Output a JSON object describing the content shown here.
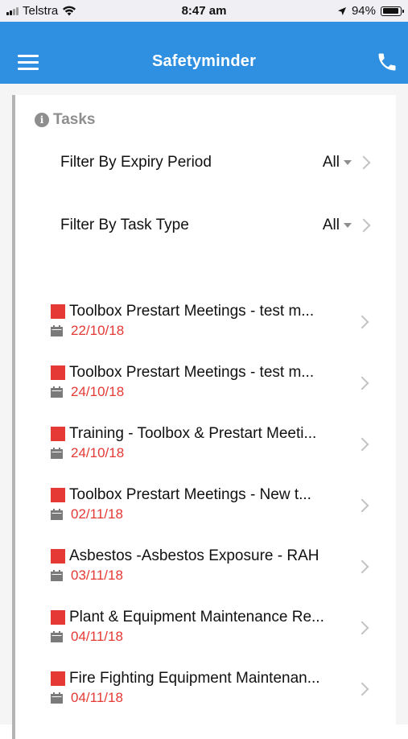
{
  "status_bar": {
    "carrier": "Telstra",
    "time": "8:47 am",
    "battery": "94%"
  },
  "header": {
    "title": "Safetyminder"
  },
  "section": {
    "title": "Tasks"
  },
  "filters": [
    {
      "label": "Filter By Expiry Period",
      "value": "All"
    },
    {
      "label": "Filter By Task Type",
      "value": "All"
    }
  ],
  "tasks": [
    {
      "title": "Toolbox Prestart Meetings - test m...",
      "date": "22/10/18"
    },
    {
      "title": "Toolbox Prestart Meetings - test m...",
      "date": "24/10/18"
    },
    {
      "title": "Training - Toolbox & Prestart Meeti...",
      "date": "24/10/18"
    },
    {
      "title": "Toolbox Prestart Meetings - New t...",
      "date": "02/11/18"
    },
    {
      "title": "Asbestos -Asbestos Exposure - RAH",
      "date": "03/11/18"
    },
    {
      "title": "Plant & Equipment Maintenance Re...",
      "date": "04/11/18"
    },
    {
      "title": "Fire Fighting Equipment Maintenan...",
      "date": "04/11/18"
    }
  ],
  "colors": {
    "header_bg": "#2f8fe0",
    "overdue_flag": "#e53935",
    "muted": "#8e8e8e"
  },
  "icons": [
    "menu-icon",
    "phone-icon",
    "info-icon",
    "calendar-icon",
    "chevron-right-icon",
    "wifi-icon",
    "location-arrow-icon",
    "battery-icon"
  ]
}
